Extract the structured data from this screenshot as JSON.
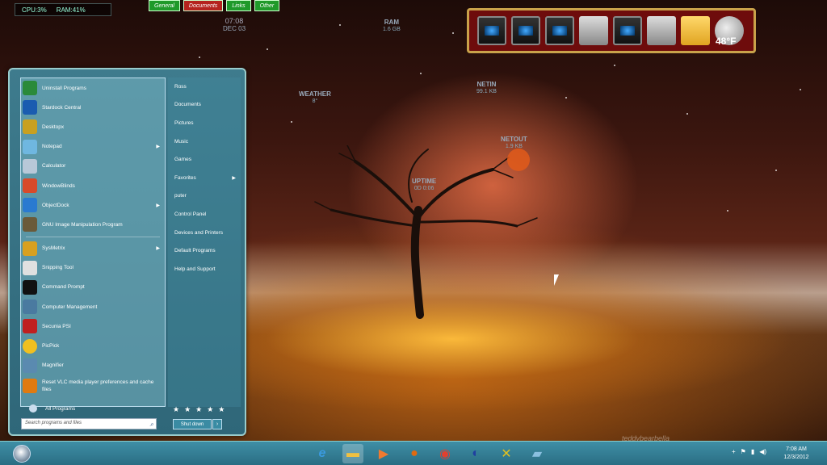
{
  "system_bar": {
    "cpu": "CPU:3%",
    "ram": "RAM:41%"
  },
  "top_tabs": [
    {
      "label": "General",
      "color": "#1f9a2a"
    },
    {
      "label": "Documents",
      "color": "#b5231e"
    },
    {
      "label": "Links",
      "color": "#1f9a2a"
    },
    {
      "label": "Other",
      "color": "#1f9a2a"
    }
  ],
  "desktop_clock": {
    "time": "07:08",
    "date": "DEC 03"
  },
  "meters": {
    "ram": {
      "label": "RAM",
      "value": "1.6 GB"
    },
    "weather": {
      "label": "WEATHER",
      "value": "8°"
    },
    "netin": {
      "label": "NETIN",
      "value": "99.1 KB"
    },
    "netout": {
      "label": "NETOUT",
      "value": "1.9 KB"
    },
    "uptime": {
      "label": "UPTIME",
      "value": "0D 0:06"
    }
  },
  "dock": {
    "temperature": "48°F"
  },
  "start_menu": {
    "programs": [
      {
        "label": "Uninstall Programs",
        "icon": "uninstall-icon",
        "color": "#2a8a3a",
        "arrow": false
      },
      {
        "label": "Stardock Central",
        "icon": "stardock-icon",
        "color": "#1a5cb0",
        "arrow": false
      },
      {
        "label": "Desktopx",
        "icon": "desktopx-icon",
        "color": "#c9a020",
        "arrow": false
      },
      {
        "label": "Notepad",
        "icon": "notepad-icon",
        "color": "#6fb7e0",
        "arrow": true
      },
      {
        "label": "Calculator",
        "icon": "calculator-icon",
        "color": "#b8c8d8",
        "arrow": false
      },
      {
        "label": "WindowBlinds",
        "icon": "windowblinds-icon",
        "color": "#d84a2a",
        "arrow": false
      },
      {
        "label": "ObjectDock",
        "icon": "objectdock-icon",
        "color": "#2a7ad0",
        "arrow": true
      },
      {
        "label": "GNU Image Manipulation Program",
        "icon": "gimp-icon",
        "color": "#6a5a3a",
        "arrow": false
      },
      {
        "label": "SysMetrix",
        "icon": "sysmetrix-icon",
        "color": "#d8a020",
        "arrow": true
      },
      {
        "label": "Snipping Tool",
        "icon": "scissors-icon",
        "color": "#e0e0e0",
        "arrow": false
      },
      {
        "label": "Command Prompt",
        "icon": "cmd-icon",
        "color": "#111111",
        "arrow": false
      },
      {
        "label": "Computer Management",
        "icon": "computer-management-icon",
        "color": "#4a7aa0",
        "arrow": false
      },
      {
        "label": "Secunia PSI",
        "icon": "secunia-icon",
        "color": "#c02020",
        "arrow": false
      },
      {
        "label": "PicPick",
        "icon": "picpick-icon",
        "color": "#f0c020",
        "arrow": false
      },
      {
        "label": "Magnifier",
        "icon": "magnifier-icon",
        "color": "#5a8ab0",
        "arrow": false
      },
      {
        "label": "Reset VLC media player preferences and cache files",
        "icon": "vlc-icon",
        "color": "#e07a10",
        "arrow": false
      }
    ],
    "all_programs": "All Programs",
    "search_placeholder": "Search programs and files",
    "places": [
      {
        "label": "Ross",
        "arrow": false
      },
      {
        "label": "Documents",
        "arrow": false
      },
      {
        "label": "Pictures",
        "arrow": false
      },
      {
        "label": "Music",
        "arrow": false
      },
      {
        "label": "Games",
        "arrow": false
      },
      {
        "label": "Favorites",
        "arrow": true
      },
      {
        "label": "puter",
        "arrow": false
      },
      {
        "label": "Control Panel",
        "arrow": false
      },
      {
        "label": "Devices and Printers",
        "arrow": false
      },
      {
        "label": "Default Programs",
        "arrow": false
      },
      {
        "label": "Help and Support",
        "arrow": false
      }
    ],
    "shutdown": "Shut down"
  },
  "taskbar": {
    "pinned": [
      {
        "name": "internet-explorer-icon",
        "glyph": "e",
        "color": "#3a9ae0"
      },
      {
        "name": "file-explorer-icon",
        "glyph": "▬",
        "color": "#f0c040"
      },
      {
        "name": "media-player-icon",
        "glyph": "▶",
        "color": "#f07a30"
      },
      {
        "name": "firefox-icon",
        "glyph": "●",
        "color": "#e06a10"
      },
      {
        "name": "chrome-icon",
        "glyph": "◉",
        "color": "#e04030"
      },
      {
        "name": "objectdock-taskbar-icon",
        "glyph": "◐",
        "color": "#2040a0"
      },
      {
        "name": "tools-icon",
        "glyph": "✕",
        "color": "#e0c020"
      },
      {
        "name": "notepad-taskbar-icon",
        "glyph": "▰",
        "color": "#8ac0e0"
      }
    ],
    "time": "7:08 AM",
    "date": "12/3/2012"
  },
  "watermark": "teddybearbella"
}
